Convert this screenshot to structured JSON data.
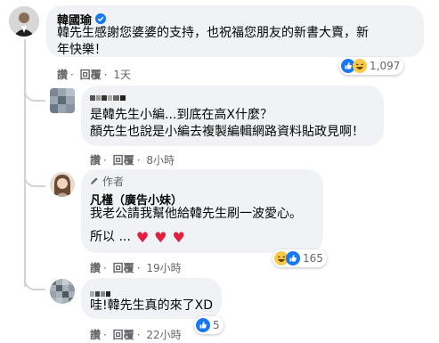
{
  "comment1": {
    "author": "韓國瑜",
    "text_line1": "韓先生感謝您婆婆的支持，也祝福您朋友的新書大賣，新",
    "text_line2": "年快樂！",
    "actions": {
      "like": "讚",
      "reply": "回覆",
      "time": "1天"
    },
    "reactions": {
      "count": "1,097",
      "types": [
        "like",
        "haha"
      ]
    }
  },
  "reply1": {
    "text_line1": "是韓先生小編...到底在高X什麼？",
    "text_line2": "顏先生也說是小編去複製編輯網路資料貼政見啊！",
    "actions": {
      "like": "讚",
      "reply": "回覆",
      "time": "8小時"
    }
  },
  "reply2": {
    "author_badge": "作者",
    "author": "凡槿（廣告小妹）",
    "text_line1": "我老公請我幫他給韓先生刷一波愛心。",
    "text_line2_prefix": "所以 ...",
    "hearts": "♥",
    "actions": {
      "like": "讚",
      "reply": "回覆",
      "time": "19小時"
    },
    "reactions": {
      "count": "165",
      "types": [
        "haha",
        "like"
      ]
    }
  },
  "reply3": {
    "text": "哇!韓先生真的來了XD",
    "actions": {
      "like": "讚",
      "reply": "回覆",
      "time": "22小時"
    },
    "reactions": {
      "count": "5",
      "types": [
        "like"
      ]
    }
  },
  "colors": {
    "bubble": "#f0f2f5",
    "meta": "#65676b",
    "like_blue": "#1877f2",
    "heart_red": "#e41e3f",
    "haha_yellow": "#f7c948"
  }
}
